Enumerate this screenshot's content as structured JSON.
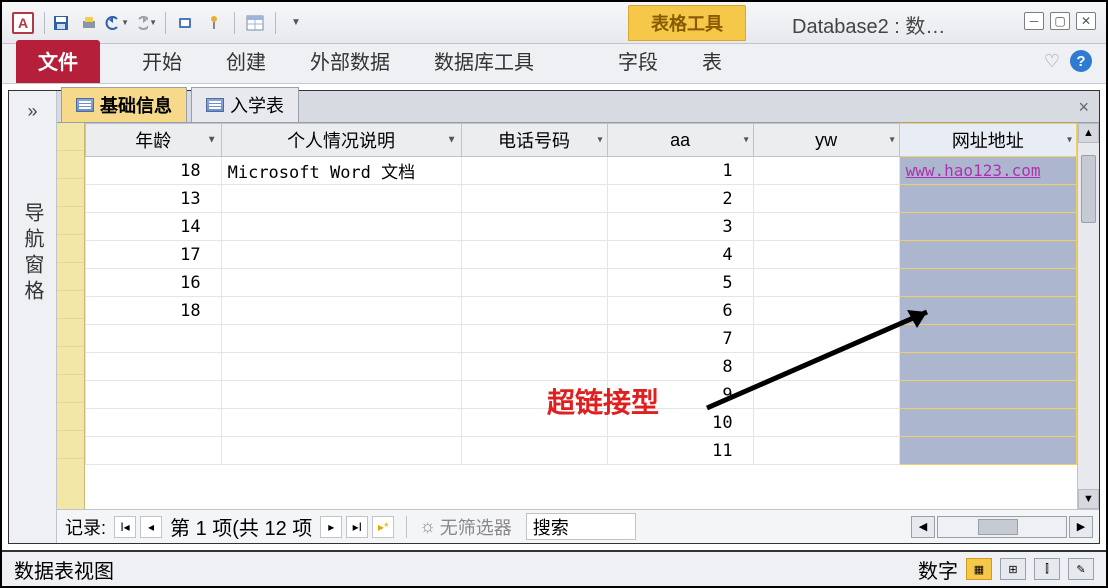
{
  "title": "Database2 : 数…",
  "context_tab": "表格工具",
  "ribbon": {
    "file": "文件",
    "home": "开始",
    "create": "创建",
    "external": "外部数据",
    "dbtools": "数据库工具",
    "fields": "字段",
    "table": "表"
  },
  "nav_pane_label": "导航窗格",
  "object_tabs": {
    "active": "基础信息",
    "second": "入学表"
  },
  "columns": [
    "年龄",
    "个人情况说明",
    "电话号码",
    "aa",
    "yw",
    "网址地址"
  ],
  "rows": [
    {
      "age": "18",
      "desc": "Microsoft Word 文档",
      "phone": "",
      "aa": "1",
      "yw": "",
      "url": "www.hao123.com"
    },
    {
      "age": "13",
      "desc": "",
      "phone": "",
      "aa": "2",
      "yw": "",
      "url": ""
    },
    {
      "age": "14",
      "desc": "",
      "phone": "",
      "aa": "3",
      "yw": "",
      "url": ""
    },
    {
      "age": "17",
      "desc": "",
      "phone": "",
      "aa": "4",
      "yw": "",
      "url": ""
    },
    {
      "age": "16",
      "desc": "",
      "phone": "",
      "aa": "5",
      "yw": "",
      "url": ""
    },
    {
      "age": "18",
      "desc": "",
      "phone": "",
      "aa": "6",
      "yw": "",
      "url": ""
    },
    {
      "age": "",
      "desc": "",
      "phone": "",
      "aa": "7",
      "yw": "",
      "url": ""
    },
    {
      "age": "",
      "desc": "",
      "phone": "",
      "aa": "8",
      "yw": "",
      "url": ""
    },
    {
      "age": "",
      "desc": "",
      "phone": "",
      "aa": "9",
      "yw": "",
      "url": ""
    },
    {
      "age": "",
      "desc": "",
      "phone": "",
      "aa": "10",
      "yw": "",
      "url": ""
    },
    {
      "age": "",
      "desc": "",
      "phone": "",
      "aa": "11",
      "yw": "",
      "url": ""
    }
  ],
  "record_nav": {
    "label": "记录:",
    "position": "第 1 项(共 12 项",
    "filter": "无筛选器",
    "search": "搜索"
  },
  "status": {
    "view": "数据表视图",
    "mode": "数字"
  },
  "annotation": "超链接型"
}
